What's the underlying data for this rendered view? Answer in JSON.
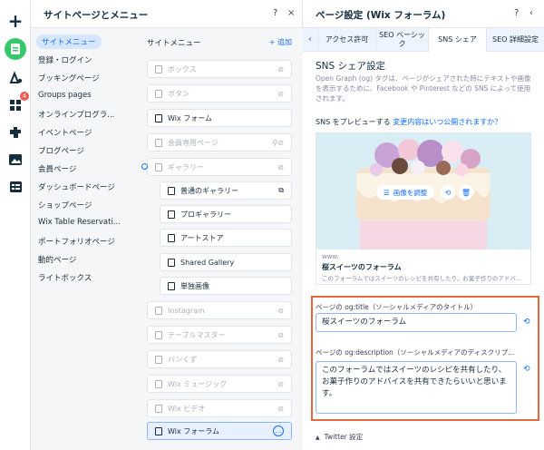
{
  "colors": {
    "accent": "#116dff",
    "green": "#35c96b",
    "highlight": "#e5673e"
  },
  "left_rail": {
    "icons": [
      "plus-icon",
      "pages-icon",
      "design-icon",
      "apps-icon",
      "puzzle-icon",
      "media-icon",
      "table-icon"
    ],
    "apps_badge": "4"
  },
  "panel1": {
    "title": "サイトページとメニュー",
    "help": "?",
    "close": "×",
    "menus": [
      "サイトメニュー",
      "登録・ログイン",
      "ブッキングページ",
      "Groups pages",
      "オンラインプログラ...",
      "イベントページ",
      "ブログページ",
      "会員ページ",
      "ダッシュボードページ",
      "ショップページ",
      "Wix Table Reservati...",
      "ポートフォリオページ",
      "動的ページ",
      "ライトボックス"
    ],
    "site_menu_title": "サイトメニュー",
    "add_label": "+ 追加",
    "pages": [
      "ボックス",
      "ボタン",
      "Wix フォーム",
      "会員専用ページ",
      "ギャラリー",
      "普通のギャラリー",
      "プロギャラリー",
      "アートストア",
      "Shared Gallery",
      "単独画像",
      "Instagram",
      "テーブルマスター",
      "パンくず",
      "Wix ミュージック",
      "Wix ビデオ",
      "Wix フォーラム"
    ]
  },
  "panel2": {
    "title": "ページ設定 (Wix フォーラム)",
    "help": "?",
    "back": "‹",
    "tabs": [
      "アクセス許可",
      "SEO ベーシック",
      "SNS シェア",
      "SEO 詳細設定"
    ],
    "section_title": "SNS シェア設定",
    "section_desc": "Open Graph (og) タグは、ページがシェアされた時にテキストや画像を表示するために、Facebook や Pinterest などの SNS によって使用されます。",
    "preview_prefix": "SNS をプレビューする",
    "preview_link": "変更内容はいつ公開されますか？",
    "adjust_image": "画像を調整",
    "preview_url": "www.",
    "preview_title": "桜スイーツのフォーラム",
    "preview_desc": "このフォーラムではスイーツのレシピを共有したり、お菓子作りのアドバ...",
    "og_title_label": "ページの og:title（ソーシャルメディアのタイトル）",
    "og_title_value": "桜スイーツのフォーラム",
    "og_desc_label": "ページの og:description（ソーシャルメディアのディスクリプ...",
    "og_desc_value": "このフォーラムではスイーツのレシピを共有したり、お菓子作りのアドバイスを共有できたらいいと思います。",
    "twitter_label": "Twitter 設定"
  }
}
